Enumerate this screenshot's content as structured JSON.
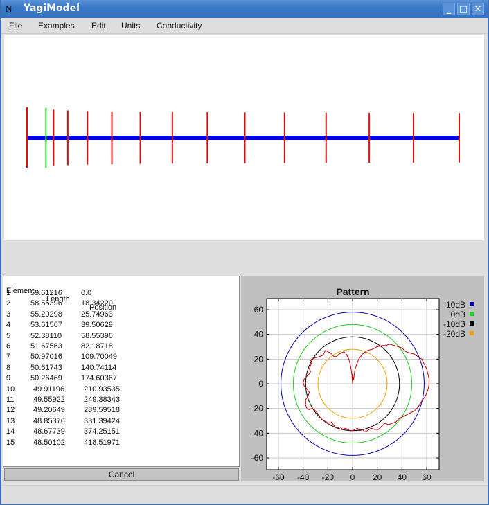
{
  "window": {
    "title": "YagiModel",
    "app_icon": "N",
    "controls": {
      "minimize": "_",
      "maximize": "□",
      "close": "✕"
    }
  },
  "menu": [
    "File",
    "Examples",
    "Edit",
    "Units",
    "Conductivity"
  ],
  "antenna_view": {
    "boom_color": "#0000ee",
    "element_color": "#dd1111",
    "driven_color": "#22dd22",
    "driven_element_index": 1
  },
  "table": {
    "headers": [
      "Element",
      "Length",
      "Position"
    ],
    "rows": [
      [
        "1",
        "59.61216",
        "0.0"
      ],
      [
        "2",
        "58.55396",
        "18.34220"
      ],
      [
        "3",
        "55.20298",
        "25.74963"
      ],
      [
        "4",
        "53.61567",
        "39.50629"
      ],
      [
        "5",
        "52.38110",
        "58.55396"
      ],
      [
        "6",
        "51.67563",
        "82.18718"
      ],
      [
        "7",
        "50.97016",
        "109.70049"
      ],
      [
        "8",
        "50.61743",
        "140.74114"
      ],
      [
        "9",
        "50.26469",
        "174.60367"
      ],
      [
        "10",
        "49.91196",
        "210.93535"
      ],
      [
        "11",
        "49.55922",
        "249.38343"
      ],
      [
        "12",
        "49.20649",
        "289.59518"
      ],
      [
        "13",
        "48.85376",
        "331.39424"
      ],
      [
        "14",
        "48.67739",
        "374.25151"
      ],
      [
        "15",
        "48.50102",
        "418.51971"
      ]
    ]
  },
  "cancel_label": "Cancel",
  "chart_data": {
    "type": "line",
    "title": "Pattern",
    "xlabel": "",
    "ylabel": "",
    "xlim": [
      -68,
      68
    ],
    "ylim": [
      -68,
      68
    ],
    "xticks": [
      -60,
      -40,
      -20,
      0,
      20,
      40,
      60
    ],
    "yticks": [
      60,
      40,
      20,
      0,
      -20,
      -40,
      -60
    ],
    "grid": true,
    "legend_position": "top-right",
    "reference_circles": [
      {
        "name": "10dB",
        "radius": 58,
        "color": "#0000aa"
      },
      {
        "name": "0dB",
        "radius": 48,
        "color": "#22cc22"
      },
      {
        "name": "-10dB",
        "radius": 38,
        "color": "#000000"
      },
      {
        "name": "-20dB",
        "radius": 28,
        "color": "#f0a000"
      }
    ],
    "pattern_series": {
      "name": "pattern",
      "color": "#cc0000",
      "points": [
        [
          0,
          0
        ],
        [
          0,
          8
        ],
        [
          0.8,
          3
        ],
        [
          2,
          12
        ],
        [
          5,
          20
        ],
        [
          8,
          24
        ],
        [
          12,
          27
        ],
        [
          16,
          28
        ],
        [
          20,
          30
        ],
        [
          24,
          31
        ],
        [
          27,
          31
        ],
        [
          30,
          32
        ],
        [
          34,
          31
        ],
        [
          37,
          30
        ],
        [
          40,
          29
        ],
        [
          43,
          26
        ],
        [
          46,
          25
        ],
        [
          50,
          24
        ],
        [
          53,
          22
        ],
        [
          56,
          20
        ],
        [
          58,
          16
        ],
        [
          60,
          12
        ],
        [
          61,
          8
        ],
        [
          62,
          4
        ],
        [
          62,
          0
        ],
        [
          61,
          -5
        ],
        [
          59,
          -10
        ],
        [
          56,
          -14
        ],
        [
          53,
          -19
        ],
        [
          50,
          -22
        ],
        [
          46,
          -24
        ],
        [
          42,
          -26
        ],
        [
          38,
          -28
        ],
        [
          35,
          -31
        ],
        [
          32,
          -32
        ],
        [
          29,
          -33
        ],
        [
          26,
          -32
        ],
        [
          24,
          -34
        ],
        [
          21,
          -37
        ],
        [
          18,
          -37
        ],
        [
          15,
          -36
        ],
        [
          12,
          -38
        ],
        [
          10,
          -39
        ],
        [
          8,
          -37
        ],
        [
          6,
          -38
        ],
        [
          4,
          -36
        ],
        [
          2,
          -37
        ],
        [
          0,
          -38
        ],
        [
          -2,
          -38
        ],
        [
          -4,
          -37
        ],
        [
          -6,
          -36
        ],
        [
          -8,
          -37
        ],
        [
          -10,
          -35
        ],
        [
          -13,
          -36
        ],
        [
          -15,
          -34
        ],
        [
          -17,
          -31
        ],
        [
          -19,
          -33
        ],
        [
          -21,
          -31
        ],
        [
          -23,
          -30
        ],
        [
          -25,
          -29
        ],
        [
          -27,
          -26
        ],
        [
          -29,
          -23
        ],
        [
          -31,
          -21
        ],
        [
          -33,
          -20
        ],
        [
          -35,
          -21
        ],
        [
          -37,
          -20
        ],
        [
          -38,
          -17
        ],
        [
          -38,
          -13
        ],
        [
          -36,
          -10
        ],
        [
          -35,
          -7
        ],
        [
          -37,
          -4
        ],
        [
          -39,
          -2
        ],
        [
          -40,
          1
        ],
        [
          -39,
          4
        ],
        [
          -37,
          6
        ],
        [
          -35,
          8
        ],
        [
          -34,
          10
        ],
        [
          -35,
          12
        ],
        [
          -34,
          15
        ],
        [
          -33,
          17
        ],
        [
          -34,
          19
        ],
        [
          -33,
          20
        ],
        [
          -30,
          21
        ],
        [
          -27,
          22
        ],
        [
          -24,
          23
        ],
        [
          -23,
          25
        ],
        [
          -22,
          27
        ],
        [
          -20,
          26
        ],
        [
          -18,
          25
        ],
        [
          -17,
          24
        ],
        [
          -15,
          22
        ],
        [
          -13,
          22
        ],
        [
          -11,
          24
        ],
        [
          -9,
          25
        ],
        [
          -7,
          26
        ],
        [
          -5,
          24
        ],
        [
          -3,
          20
        ],
        [
          -1.5,
          14
        ],
        [
          -0.5,
          7
        ],
        [
          0,
          0
        ]
      ]
    }
  }
}
